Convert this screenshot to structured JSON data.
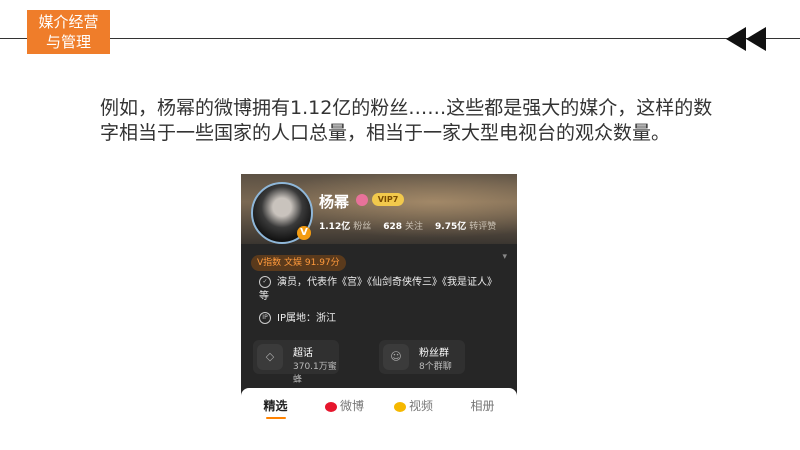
{
  "header": {
    "title_line1": "媒介经营",
    "title_line2": "与管理",
    "accent_color": "#ef7d2a",
    "nav_icon": "double-left-arrow-icon"
  },
  "paragraph": "例如，杨幂的微博拥有1.12亿的粉丝……这些都是强大的媒介，这样的数字相当于一些国家的人口总量，相当于一家大型电视台的观众数量。",
  "profile": {
    "name": "杨幂",
    "vip_badge": "VIP7",
    "verified_mark": "V",
    "stats": [
      {
        "value": "1.12亿",
        "label": "粉丝"
      },
      {
        "value": "628",
        "label": "关注"
      },
      {
        "value": "9.75亿",
        "label": "转评赞"
      }
    ],
    "v_index": "V指数 文娱 91.97分",
    "bio": "演员，代表作《宫》《仙剑奇侠传三》《我是证人》等",
    "ip": "IP属地：浙江",
    "cards": [
      {
        "title": "超话",
        "subtitle": "370.1万蜜蜂",
        "icon": "diamond-icon"
      },
      {
        "title": "粉丝群",
        "subtitle": "8个群聊",
        "icon": "group-icon"
      }
    ],
    "tabs": [
      "精选",
      "微博",
      "视频",
      "相册"
    ]
  }
}
